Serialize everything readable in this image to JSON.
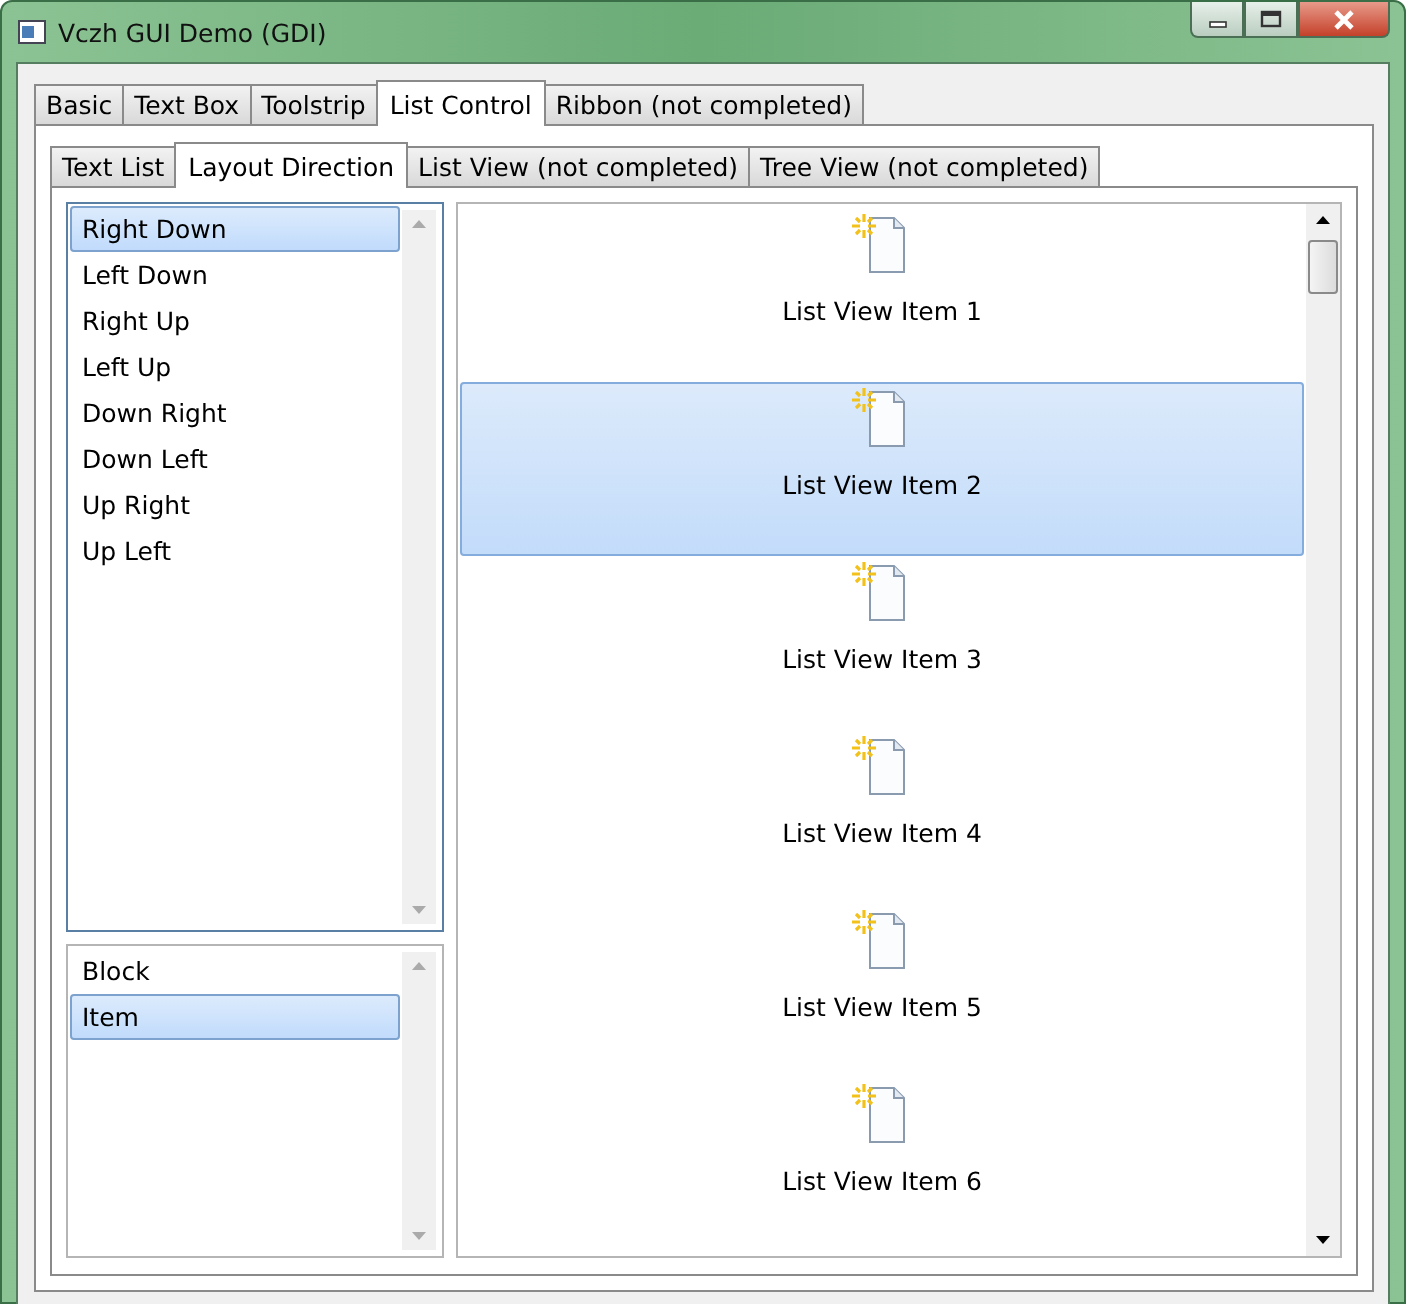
{
  "window": {
    "title": "Vczh GUI Demo (GDI)"
  },
  "tabs": [
    {
      "label": "Basic",
      "selected": false
    },
    {
      "label": "Text Box",
      "selected": false
    },
    {
      "label": "Toolstrip",
      "selected": false
    },
    {
      "label": "List Control",
      "selected": true
    },
    {
      "label": "Ribbon (not completed)",
      "selected": false
    }
  ],
  "sub_tabs": [
    {
      "label": "Text List",
      "selected": false
    },
    {
      "label": "Layout Direction",
      "selected": true
    },
    {
      "label": "List View (not completed)",
      "selected": false
    },
    {
      "label": "Tree View (not completed)",
      "selected": false
    }
  ],
  "direction_list": {
    "items": [
      {
        "label": "Right Down",
        "selected": true
      },
      {
        "label": "Left Down",
        "selected": false
      },
      {
        "label": "Right Up",
        "selected": false
      },
      {
        "label": "Left Up",
        "selected": false
      },
      {
        "label": "Down Right",
        "selected": false
      },
      {
        "label": "Down Left",
        "selected": false
      },
      {
        "label": "Up Right",
        "selected": false
      },
      {
        "label": "Up Left",
        "selected": false
      }
    ]
  },
  "mode_list": {
    "items": [
      {
        "label": "Block",
        "selected": false
      },
      {
        "label": "Item",
        "selected": true
      }
    ]
  },
  "list_view": {
    "items": [
      {
        "label": "List View Item 1",
        "selected": false
      },
      {
        "label": "List View Item 2",
        "selected": true
      },
      {
        "label": "List View Item 3",
        "selected": false
      },
      {
        "label": "List View Item 4",
        "selected": false
      },
      {
        "label": "List View Item 5",
        "selected": false
      },
      {
        "label": "List View Item 6",
        "selected": false
      }
    ]
  }
}
